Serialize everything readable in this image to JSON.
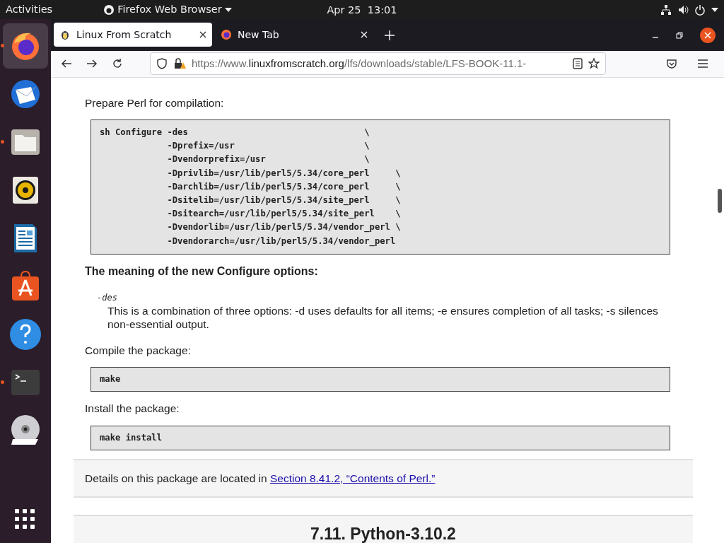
{
  "top_bar": {
    "activities": "Activities",
    "app_menu": "Firefox Web Browser",
    "clock": "Apr 25  13:01"
  },
  "dock": [
    {
      "kind": "firefox",
      "selected": true,
      "running": true
    },
    {
      "kind": "mail",
      "selected": false,
      "running": false
    },
    {
      "kind": "files",
      "selected": false,
      "running": true
    },
    {
      "kind": "speaker",
      "selected": false,
      "running": false
    },
    {
      "kind": "writer",
      "selected": false,
      "running": false
    },
    {
      "kind": "store",
      "selected": false,
      "running": false
    },
    {
      "kind": "help",
      "selected": false,
      "running": false
    },
    {
      "kind": "terminal",
      "selected": false,
      "running": true
    },
    {
      "kind": "dvd",
      "selected": false,
      "running": false
    }
  ],
  "tabs": [
    {
      "label": "Linux From Scratch",
      "kind": "lfs",
      "selected": true
    },
    {
      "label": "New Tab",
      "kind": "firefox",
      "selected": false
    }
  ],
  "url": {
    "domain_before": "https://www.",
    "domain": "linuxfromscratch.org",
    "path": "/lfs/downloads/stable/LFS-BOOK-11.1-"
  },
  "content": [
    {
      "kind": "para",
      "text": "Prepare Perl for compilation:"
    },
    {
      "kind": "code",
      "text": "sh Configure -des                                  \\\n             -Dprefix=/usr                         \\\n             -Dvendorprefix=/usr                   \\\n             -Dprivlib=/usr/lib/perl5/5.34/core_perl     \\\n             -Darchlib=/usr/lib/perl5/5.34/core_perl     \\\n             -Dsitelib=/usr/lib/perl5/5.34/site_perl     \\\n             -Dsitearch=/usr/lib/perl5/5.34/site_perl    \\\n             -Dvendorlib=/usr/lib/perl5/5.34/vendor_perl \\\n             -Dvendorarch=/usr/lib/perl5/5.34/vendor_perl"
    },
    {
      "kind": "subheading",
      "text": "The meaning of the new Configure options:"
    },
    {
      "kind": "term",
      "text": "-des"
    },
    {
      "kind": "definition",
      "text": "This is a combination of three options: -d uses defaults for all items; -e ensures completion of all tasks; -s silences non-essential output."
    },
    {
      "kind": "para",
      "text": "Compile the package:"
    },
    {
      "kind": "code",
      "text": "make"
    },
    {
      "kind": "para",
      "text": "Install the package:"
    },
    {
      "kind": "code",
      "text": "make install"
    }
  ],
  "note": {
    "text": "Details on this package are located in",
    "link": "Section 8.41.2, “Contents of Perl.”"
  },
  "next_heading": "7.11. Python-3.10.2"
}
